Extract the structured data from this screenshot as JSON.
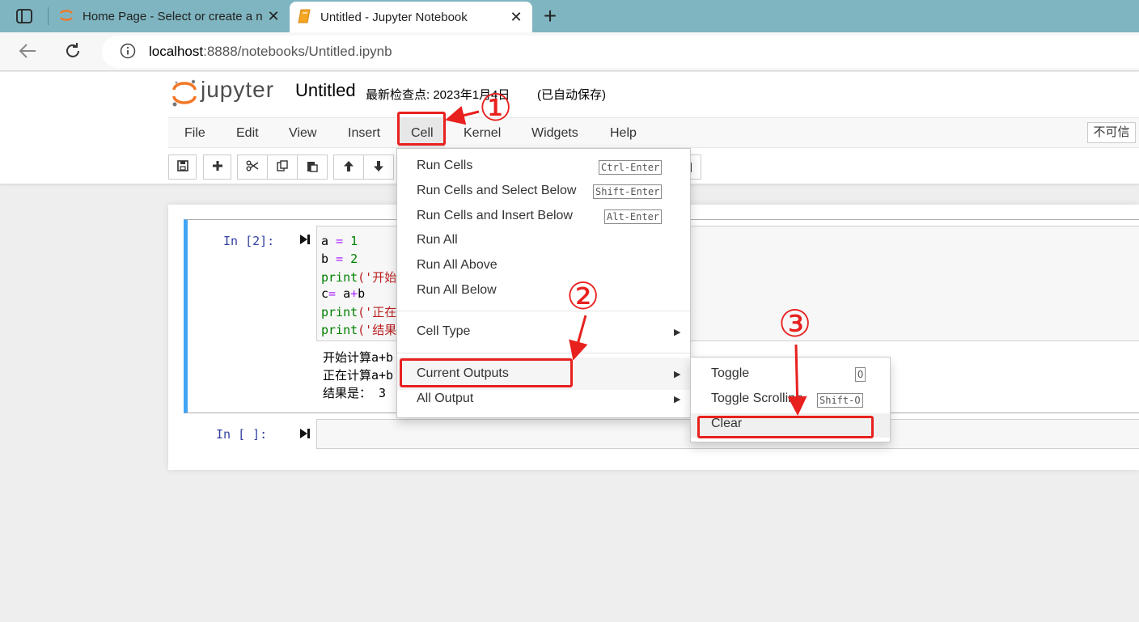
{
  "browser": {
    "tabs": [
      {
        "title": "Home Page - Select or create a n",
        "active": false
      },
      {
        "title": "Untitled - Jupyter Notebook",
        "active": true
      }
    ],
    "url_host": "localhost",
    "url_rest": ":8888/notebooks/Untitled.ipynb"
  },
  "header": {
    "logo_text": "jupyter",
    "notebook_name": "Untitled",
    "checkpoint": "最新检查点: 2023年1月4日",
    "autosave": "(已自动保存)"
  },
  "menubar": {
    "items": [
      "File",
      "Edit",
      "View",
      "Insert",
      "Cell",
      "Kernel",
      "Widgets",
      "Help"
    ],
    "not_trusted": "不可信"
  },
  "cells": [
    {
      "prompt": "In  [2]:",
      "code": [
        {
          "parts": [
            [
              "a",
              "var"
            ],
            [
              " = ",
              "op"
            ],
            [
              "1",
              "num"
            ]
          ]
        },
        {
          "parts": [
            [
              "b",
              "var"
            ],
            [
              " = ",
              "op"
            ],
            [
              "2",
              "num"
            ]
          ]
        },
        {
          "parts": [
            [
              "print",
              "fn"
            ],
            [
              "('开始",
              "str"
            ]
          ]
        },
        {
          "parts": [
            [
              "c",
              "var"
            ],
            [
              "= ",
              "op"
            ],
            [
              "a",
              "var"
            ],
            [
              "+",
              "op"
            ],
            [
              "b",
              "var"
            ]
          ]
        },
        {
          "parts": [
            [
              "print",
              "fn"
            ],
            [
              "('正在",
              "str"
            ]
          ]
        },
        {
          "parts": [
            [
              "print",
              "fn"
            ],
            [
              "('结果",
              "str"
            ]
          ]
        }
      ],
      "output": [
        "开始计算a+b",
        "正在计算a+b",
        "结果是： 3"
      ]
    },
    {
      "prompt": "In  [ ]:",
      "code": [],
      "output": []
    }
  ],
  "cell_menu": {
    "items": [
      {
        "label": "Run Cells",
        "shortcut": "Ctrl-Enter"
      },
      {
        "label": "Run Cells and Select Below",
        "shortcut": "Shift-Enter"
      },
      {
        "label": "Run Cells and Insert Below",
        "shortcut": "Alt-Enter"
      },
      {
        "label": "Run All",
        "shortcut": ""
      },
      {
        "label": "Run All Above",
        "shortcut": ""
      },
      {
        "label": "Run All Below",
        "shortcut": ""
      }
    ],
    "cell_type": "Cell Type",
    "current_outputs": "Current Outputs",
    "all_output": "All Output"
  },
  "outputs_submenu": {
    "items": [
      {
        "label": "Toggle",
        "shortcut": "O"
      },
      {
        "label": "Toggle Scrolling",
        "shortcut": "Shift-O"
      },
      {
        "label": "Clear",
        "shortcut": ""
      }
    ]
  },
  "annotations": {
    "steps": [
      "①",
      "②",
      "③"
    ],
    "color": "#e8201e"
  },
  "colors": {
    "tab_strip": "#7fb5c0",
    "selected_cell_bar": "#42a5f5",
    "prompt": "#303f9f",
    "keyword_fn": "#008000",
    "operator": "#aa22ff",
    "number": "#008000",
    "string": "#ba2121"
  },
  "icons": [
    "sidebar-toggle-icon",
    "jupyter-tab-icon",
    "notebook-tab-icon",
    "new-tab-icon",
    "back-icon",
    "reload-icon",
    "info-icon",
    "jupyter-logo-icon",
    "save-icon",
    "plus-icon",
    "cut-icon",
    "copy-icon",
    "paste-icon",
    "arrow-up-icon",
    "arrow-down-icon",
    "run-cell-icon",
    "submenu-caret-icon"
  ]
}
